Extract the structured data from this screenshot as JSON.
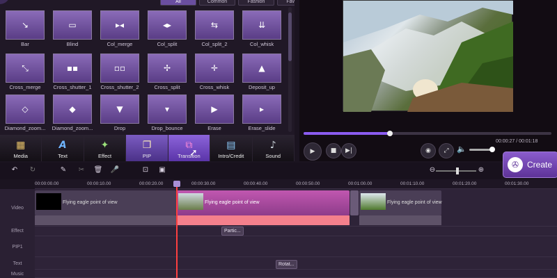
{
  "library": {
    "filters": [
      {
        "label": "All",
        "active": true
      },
      {
        "label": "Common",
        "active": false
      },
      {
        "label": "Fashion",
        "active": false
      },
      {
        "label": "Favorite",
        "active": false
      }
    ],
    "tiles": [
      {
        "label": "Bar",
        "glyph": "↘"
      },
      {
        "label": "Blind",
        "glyph": "▭"
      },
      {
        "label": "Col_merge",
        "glyph": "▸◂"
      },
      {
        "label": "Col_split",
        "glyph": "◂▸"
      },
      {
        "label": "Col_split_2",
        "glyph": "⇆"
      },
      {
        "label": "Col_whisk",
        "glyph": "⇊"
      },
      {
        "label": "Cross_merge",
        "glyph": "⤡"
      },
      {
        "label": "Cross_shutter_1",
        "glyph": "▪▪"
      },
      {
        "label": "Cross_shutter_2",
        "glyph": "▫▫"
      },
      {
        "label": "Cross_split",
        "glyph": "✢"
      },
      {
        "label": "Cross_whisk",
        "glyph": "✛"
      },
      {
        "label": "Deposit_up",
        "glyph": "▲"
      },
      {
        "label": "Diamond_zoom...",
        "glyph": "◇"
      },
      {
        "label": "Diamond_zoom...",
        "glyph": "◆"
      },
      {
        "label": "Drop",
        "glyph": "▼"
      },
      {
        "label": "Drop_bounce",
        "glyph": "▾"
      },
      {
        "label": "Erase",
        "glyph": "▶"
      },
      {
        "label": "Erase_slide",
        "glyph": "▸"
      }
    ]
  },
  "tabs": [
    {
      "label": "Media",
      "icon": "film-icon",
      "glyph": "🎞"
    },
    {
      "label": "Text",
      "icon": "text-icon",
      "glyph": "A"
    },
    {
      "label": "Effect",
      "icon": "effect-icon",
      "glyph": "✦"
    },
    {
      "label": "PIP",
      "icon": "pip-icon",
      "glyph": "❐"
    },
    {
      "label": "Transition",
      "icon": "transition-icon",
      "glyph": "⧉"
    },
    {
      "label": "Intro/Credit",
      "icon": "clapper-icon",
      "glyph": "🎬"
    },
    {
      "label": "Sound",
      "icon": "sound-icon",
      "glyph": "♪"
    }
  ],
  "active_tab": "Transition",
  "player": {
    "time_current": "00:00:27 / 00:01:18",
    "time_total": "00:01:18",
    "progress_fraction": 0.35,
    "volume_fraction": 0.85
  },
  "create": {
    "label": "Create"
  },
  "timeline": {
    "ticks": [
      "00:00:00.00",
      "00:00:10.00",
      "00:00:20.00",
      "00:00:30.00",
      "00:00:40.00",
      "00:00:50.00",
      "00:01:00.00",
      "00:01:10.00",
      "00:01:20.00",
      "00:01:30.00"
    ],
    "track_labels": [
      "Video",
      "Effect",
      "PIP1",
      "Text",
      "Music"
    ],
    "clip_title": "Flying eagle point of view",
    "effect_chip": "Partic...",
    "text_chip": "Rotat..."
  },
  "colors": {
    "accent": "#8b5cf0",
    "selected_clip": "#b04aa0",
    "playhead": "#ff4040"
  }
}
